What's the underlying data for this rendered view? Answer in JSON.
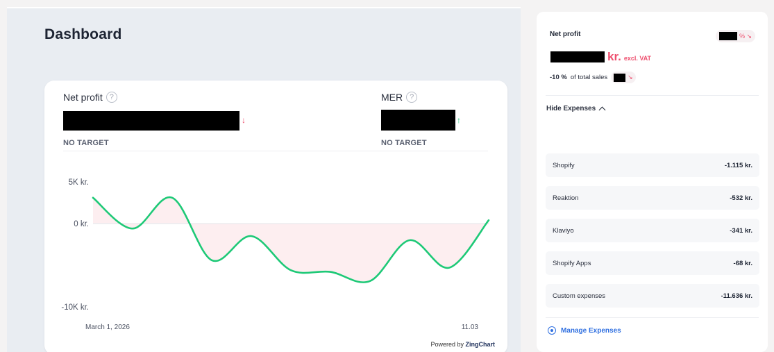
{
  "page": {
    "title": "Dashboard"
  },
  "kpis": {
    "net_profit": {
      "label": "Net profit",
      "help": "?",
      "trend": "↓",
      "target": "NO TARGET"
    },
    "mer": {
      "label": "MER",
      "help": "?",
      "trend": "↑",
      "target": "NO TARGET"
    }
  },
  "chart_data": {
    "type": "area",
    "yticks": [
      "5K kr.",
      "0 kr.",
      "-10K kr."
    ],
    "ylim": [
      -10000,
      5000
    ],
    "x_start_label": "March 1, 2026",
    "x_end_label": "11.03",
    "points": [
      {
        "x": 1,
        "y": 3100
      },
      {
        "x": 2,
        "y": -600
      },
      {
        "x": 3,
        "y": 3100
      },
      {
        "x": 4,
        "y": -4400
      },
      {
        "x": 5,
        "y": -1500
      },
      {
        "x": 6,
        "y": -5600
      },
      {
        "x": 7,
        "y": -5800
      },
      {
        "x": 8,
        "y": -6900
      },
      {
        "x": 9,
        "y": -2000
      },
      {
        "x": 10,
        "y": -5300
      },
      {
        "x": 11,
        "y": 400
      }
    ],
    "line_color": "#1ec977",
    "fill_color": "#fdeef0",
    "grid": false,
    "powered_prefix": "Powered by",
    "powered_brand": "ZingChart"
  },
  "side": {
    "net_profit_label": "Net profit",
    "pill_suffix": "% ↘",
    "kr_unit": "kr.",
    "kr_vat": "excl. VAT",
    "pct_bold": "-10 %",
    "pct_text": "of total sales",
    "pct_arrow": "↘",
    "hide_expenses": "Hide Expenses",
    "expenses": [
      {
        "name": "Shopify",
        "amount": "-1.115 kr."
      },
      {
        "name": "Reaktion",
        "amount": "-532 kr."
      },
      {
        "name": "Klaviyo",
        "amount": "-341 kr."
      },
      {
        "name": "Shopify Apps",
        "amount": "-68 kr."
      },
      {
        "name": "Custom expenses",
        "amount": "-11.636 kr."
      }
    ],
    "manage_expenses": "Manage Expenses"
  },
  "colors": {
    "negative": "#ee4f6e",
    "positive": "#21c07a",
    "link": "#2f6fe0"
  }
}
